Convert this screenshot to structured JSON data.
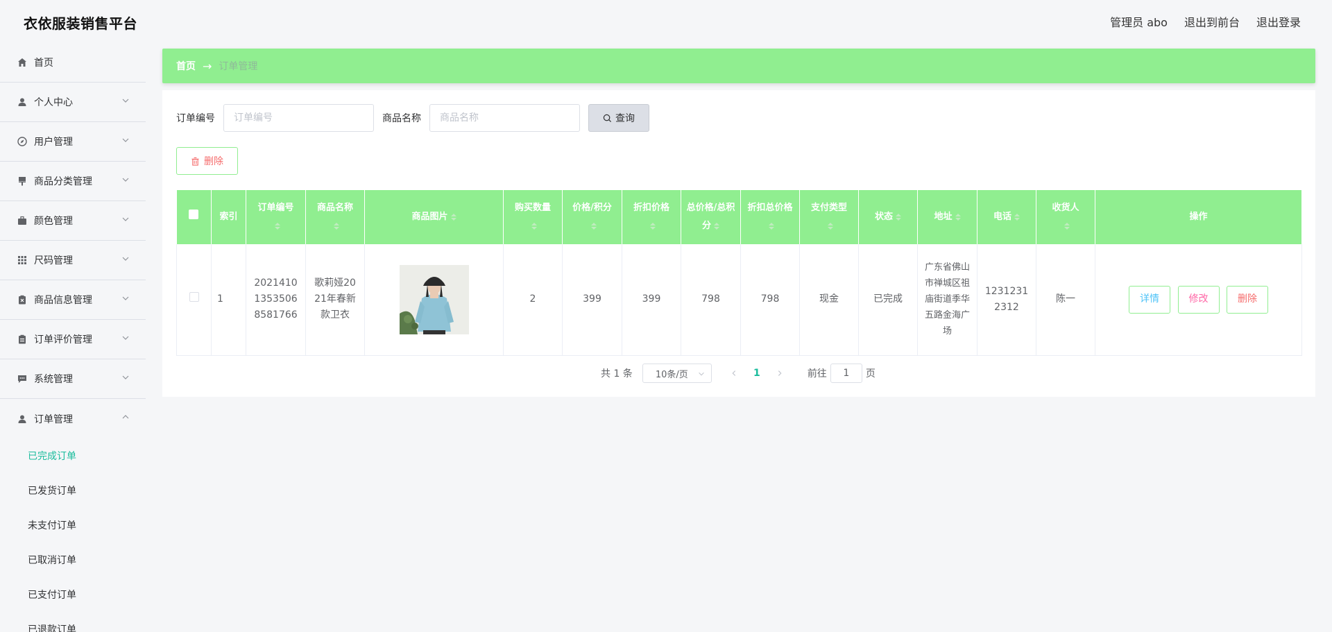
{
  "header": {
    "brand": "衣依服装销售平台",
    "admin_label": "管理员 abo",
    "exit_front": "退出到前台",
    "logout": "退出登录"
  },
  "sidebar": {
    "items": [
      {
        "label": "首页",
        "icon": "home-icon"
      },
      {
        "label": "个人中心",
        "icon": "user-icon"
      },
      {
        "label": "用户管理",
        "icon": "compass-icon"
      },
      {
        "label": "商品分类管理",
        "icon": "brush-icon"
      },
      {
        "label": "颜色管理",
        "icon": "suitcase-icon"
      },
      {
        "label": "尺码管理",
        "icon": "grid-icon"
      },
      {
        "label": "商品信息管理",
        "icon": "clipboard-x-icon"
      },
      {
        "label": "订单评价管理",
        "icon": "clipboard-icon"
      },
      {
        "label": "系统管理",
        "icon": "chat-icon"
      },
      {
        "label": "订单管理",
        "icon": "user-icon"
      }
    ],
    "submenu": [
      {
        "label": "已完成订单"
      },
      {
        "label": "已发货订单"
      },
      {
        "label": "未支付订单"
      },
      {
        "label": "已取消订单"
      },
      {
        "label": "已支付订单"
      },
      {
        "label": "已退款订单"
      }
    ]
  },
  "breadcrumb": {
    "home": "首页",
    "sep": "→",
    "current": "订单管理"
  },
  "search": {
    "order_label": "订单编号",
    "order_placeholder": "订单编号",
    "name_label": "商品名称",
    "name_placeholder": "商品名称",
    "query_label": "查询"
  },
  "actions": {
    "delete_label": "删除"
  },
  "table": {
    "headers": {
      "index": "索引",
      "order_no": "订单编号",
      "product_name": "商品名称",
      "product_image": "商品图片",
      "quantity": "购买数量",
      "price": "价格/积分",
      "discount_price": "折扣价格",
      "total_price": "总价格/总积分",
      "discount_total": "折扣总价格",
      "pay_type": "支付类型",
      "status": "状态",
      "address": "地址",
      "phone": "电话",
      "receiver": "收货人",
      "operations": "操作"
    },
    "rows": [
      {
        "index": "1",
        "order_no": "20214101353506 8581766",
        "product_name": "歌莉娅2021年春新款卫衣",
        "quantity": "2",
        "price": "399",
        "discount_price": "399",
        "total_price": "798",
        "discount_total": "798",
        "pay_type": "现金",
        "status": "已完成",
        "address": "广东省佛山市禅城区祖庙街道季华五路金海广场",
        "phone": "12312312312",
        "receiver": "陈一",
        "op_detail": "详情",
        "op_edit": "修改",
        "op_delete": "删除"
      }
    ]
  },
  "pagination": {
    "total_text": "共 1 条",
    "page_size": "10条/页",
    "current_page": "1",
    "goto_label": "前往",
    "goto_value": "1",
    "page_unit": "页"
  }
}
